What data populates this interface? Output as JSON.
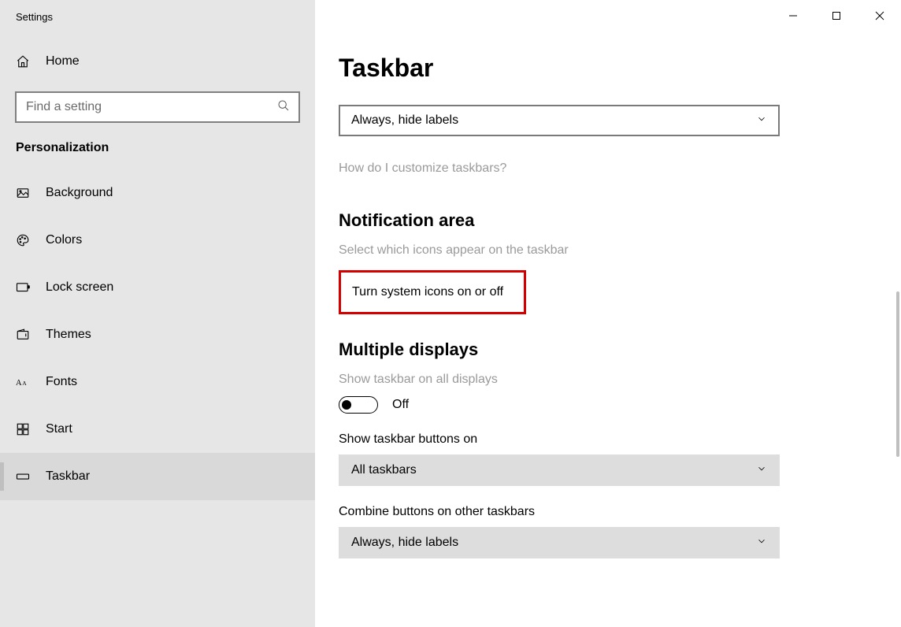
{
  "window": {
    "title": "Settings"
  },
  "sidebar": {
    "home": "Home",
    "searchPlaceholder": "Find a setting",
    "sectionLabel": "Personalization",
    "items": [
      {
        "label": "Background"
      },
      {
        "label": "Colors"
      },
      {
        "label": "Lock screen"
      },
      {
        "label": "Themes"
      },
      {
        "label": "Fonts"
      },
      {
        "label": "Start"
      },
      {
        "label": "Taskbar"
      }
    ]
  },
  "main": {
    "title": "Taskbar",
    "combineDropdownTop": "Always, hide labels",
    "helpLink": "How do I customize taskbars?",
    "notificationHeading": "Notification area",
    "selectIconsLink": "Select which icons appear on the taskbar",
    "systemIconsLink": "Turn system icons on or off",
    "multipleDisplaysHeading": "Multiple displays",
    "showAllLabel": "Show taskbar on all displays",
    "showAllToggle": "Off",
    "showButtonsOnLabel": "Show taskbar buttons on",
    "showButtonsOnValue": "All taskbars",
    "combineOtherLabel": "Combine buttons on other taskbars",
    "combineOtherValue": "Always, hide labels"
  }
}
